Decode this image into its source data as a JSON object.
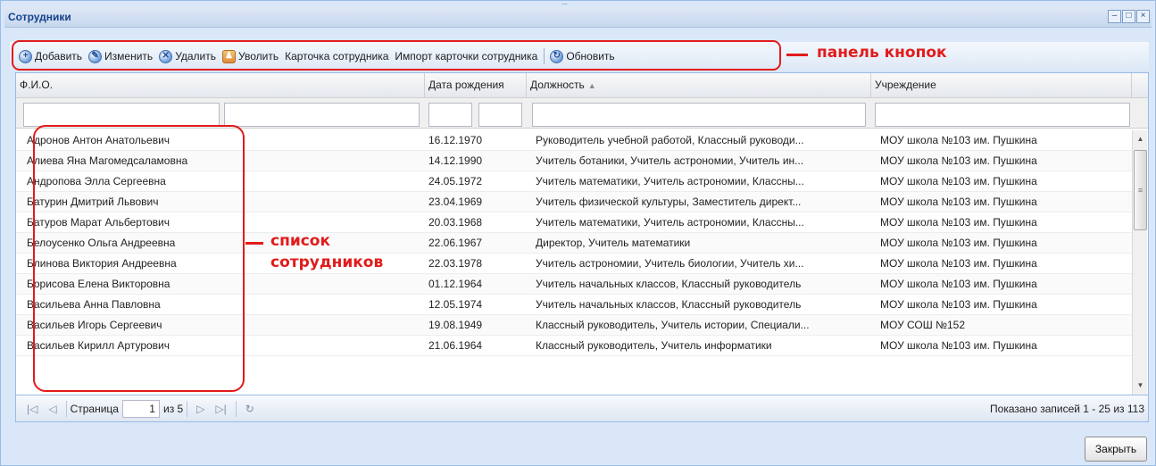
{
  "window": {
    "title": "Сотрудники",
    "minimize": "–",
    "maximize": "□",
    "close": "×",
    "grip": "::::"
  },
  "toolbar": {
    "buttons": [
      {
        "label": "Добавить",
        "icon": "+"
      },
      {
        "label": "Изменить",
        "icon": "✎"
      },
      {
        "label": "Удалить",
        "icon": "✕"
      },
      {
        "label": "Уволить",
        "icon": "♟"
      },
      {
        "label": "Карточка сотрудника"
      },
      {
        "label": "Импорт карточки сотрудника"
      },
      {
        "label": "Обновить",
        "icon": "↻"
      }
    ]
  },
  "annotations": {
    "toolbar": "панель кнопок",
    "list_line1": "список",
    "list_line2": "сотрудников",
    "color": "#e21b1b"
  },
  "grid": {
    "columns": [
      "Ф.И.О.",
      "Дата рождения",
      "Должность",
      "Учреждение"
    ],
    "sort_indicator": "▲",
    "rows": [
      [
        "Адронов Антон Анатольевич",
        "16.12.1970",
        "Руководитель учебной работой, Классный руководи...",
        "МОУ школа №103 им. Пушкина"
      ],
      [
        "Алиева Яна Магомедсаламовна",
        "14.12.1990",
        "Учитель ботаники, Учитель астрономии, Учитель ин...",
        "МОУ школа №103 им. Пушкина"
      ],
      [
        "Андропова Элла Сергеевна",
        "24.05.1972",
        "Учитель математики, Учитель астрономии, Классны...",
        "МОУ школа №103 им. Пушкина"
      ],
      [
        "Батурин Дмитрий Львович",
        "23.04.1969",
        "Учитель физической культуры, Заместитель директ...",
        "МОУ школа №103 им. Пушкина"
      ],
      [
        "Батуров Марат Альбертович",
        "20.03.1968",
        "Учитель математики, Учитель астрономии, Классны...",
        "МОУ школа №103 им. Пушкина"
      ],
      [
        "Белоусенко Ольга Андреевна",
        "22.06.1967",
        "Директор, Учитель математики",
        "МОУ школа №103 им. Пушкина"
      ],
      [
        "Блинова Виктория Андреевна",
        "22.03.1978",
        "Учитель астрономии, Учитель биологии, Учитель хи...",
        "МОУ школа №103 им. Пушкина"
      ],
      [
        "Борисова Елена Викторовна",
        "01.12.1964",
        "Учитель начальных классов, Классный руководитель",
        "МОУ школа №103 им. Пушкина"
      ],
      [
        "Васильева Анна Павловна",
        "12.05.1974",
        "Учитель начальных классов, Классный руководитель",
        "МОУ школа №103 им. Пушкина"
      ],
      [
        "Васильев Игорь Сергеевич",
        "19.08.1949",
        "Классный руководитель, Учитель истории, Специали...",
        "МОУ СОШ №152"
      ],
      [
        "Васильев Кирилл Артурович",
        "21.06.1964",
        "Классный руководитель, Учитель информатики",
        "МОУ школа №103 им. Пушкина"
      ]
    ]
  },
  "pager": {
    "page_label": "Страница",
    "page_value": "1",
    "of_label": "из 5",
    "first": "|◁",
    "prev": "◁",
    "next": "▷",
    "last": "▷|",
    "refresh": "↻",
    "info": "Показано записей 1 - 25 из 113"
  },
  "footer": {
    "close_label": "Закрыть"
  }
}
